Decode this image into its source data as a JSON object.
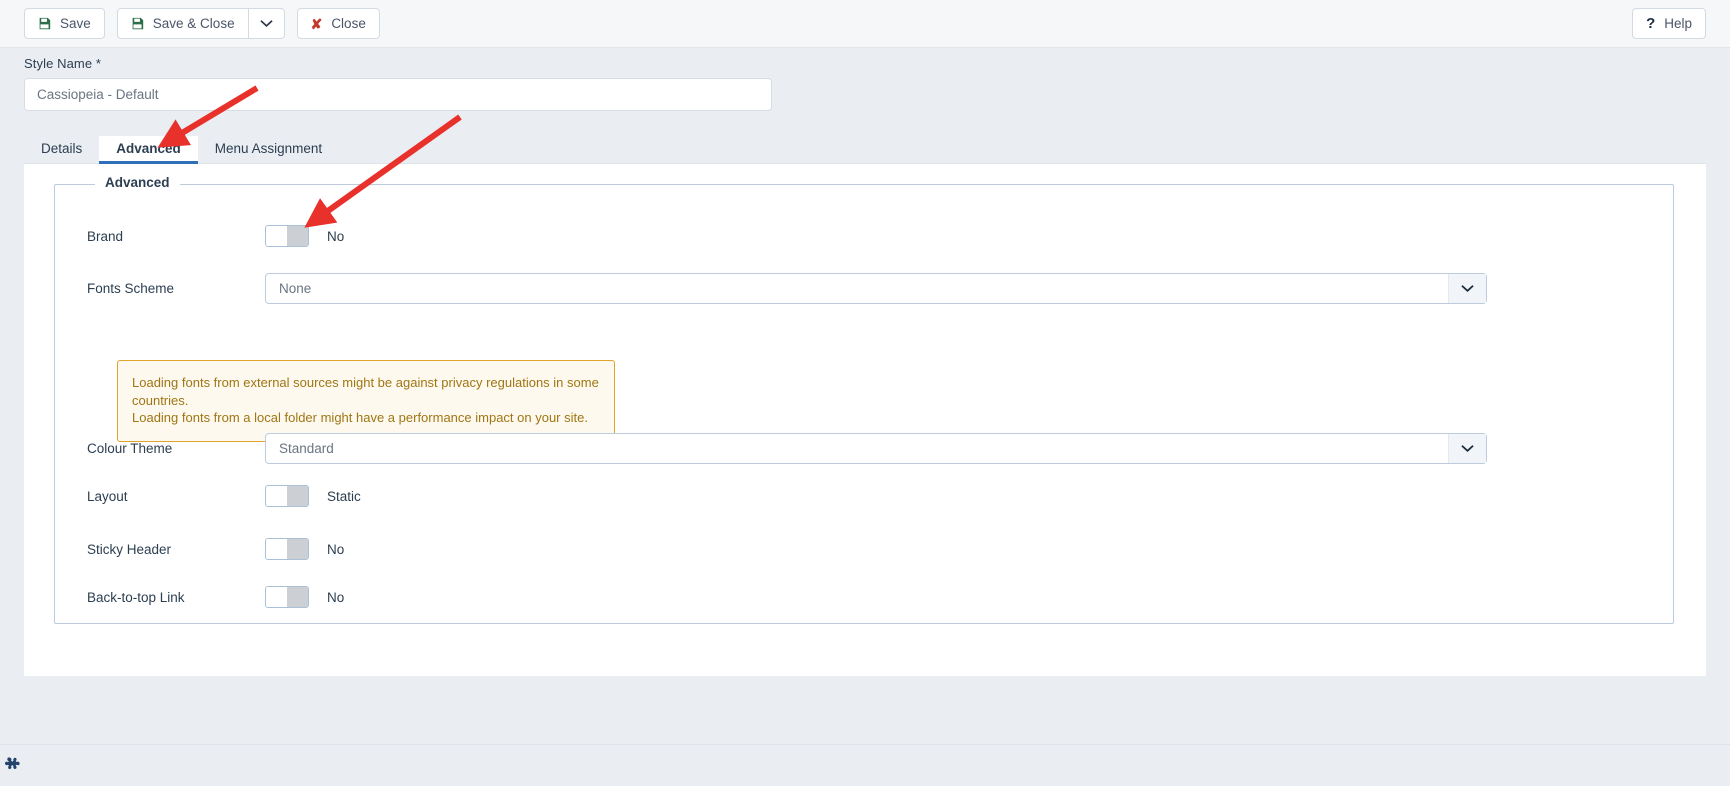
{
  "toolbar": {
    "save_label": "Save",
    "save_close_label": "Save & Close",
    "dropdown_icon": "chevron-down-icon",
    "close_label": "Close",
    "close_icon": "x-icon",
    "save_icon": "floppy-disk-icon",
    "help_label": "Help",
    "help_icon": "question-mark-icon"
  },
  "style_name": {
    "label": "Style Name *",
    "value": "Cassiopeia - Default",
    "placeholder": ""
  },
  "tabs": [
    {
      "label": "Details",
      "active": false
    },
    {
      "label": "Advanced",
      "active": true
    },
    {
      "label": "Menu Assignment",
      "active": false
    }
  ],
  "fieldset": {
    "legend": "Advanced",
    "rows": [
      {
        "label": "Brand",
        "type": "toggle",
        "state": "No"
      },
      {
        "label": "Fonts Scheme",
        "type": "select",
        "value": "None"
      },
      {
        "label": "Colour Theme",
        "type": "select",
        "value": "Standard"
      },
      {
        "label": "Layout",
        "type": "toggle",
        "state": "Static"
      },
      {
        "label": "Sticky Header",
        "type": "toggle",
        "state": "No"
      },
      {
        "label": "Back-to-top Link",
        "type": "toggle",
        "state": "No"
      }
    ]
  },
  "alert": {
    "line1": "Loading fonts from external sources might be against privacy regulations in some countries.",
    "line2": "Loading fonts from a local folder might have a performance impact on your site."
  },
  "footer": {
    "logo_icon": "joomla-logo-icon"
  },
  "colors": {
    "accent": "#2f6fb7",
    "page_bg": "#eaeef2",
    "toolbar_bg": "#f6f7f9",
    "alert_border": "#e0a42a",
    "alert_text": "#a07614",
    "annotation": "#e8312a"
  }
}
